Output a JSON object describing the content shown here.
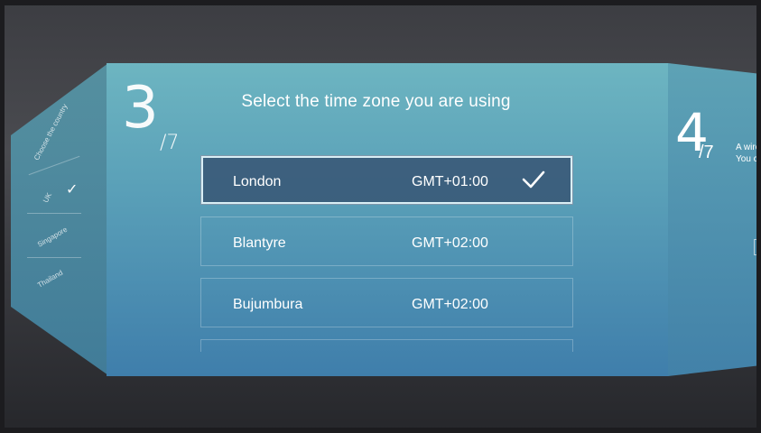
{
  "wizard": {
    "current_step": "3",
    "total_steps": "/7",
    "title": "Select the time zone you are using"
  },
  "timezones": [
    {
      "city": "London",
      "offset": "GMT+01:00",
      "selected": true
    },
    {
      "city": "Blantyre",
      "offset": "GMT+02:00",
      "selected": false
    },
    {
      "city": "Bujumbura",
      "offset": "GMT+02:00",
      "selected": false
    }
  ],
  "prev_panel": {
    "heading": "Choose the country",
    "item_1": "UK",
    "item_2": "Singapore",
    "item_3": "Thailand"
  },
  "next_panel": {
    "step": "4",
    "total": "/7",
    "desc_line_1": "A wire",
    "desc_line_2": "You ca"
  },
  "colors": {
    "panel_top": "#6db5c1",
    "panel_bottom": "#3f7eab",
    "selected_row": "#37557a"
  }
}
